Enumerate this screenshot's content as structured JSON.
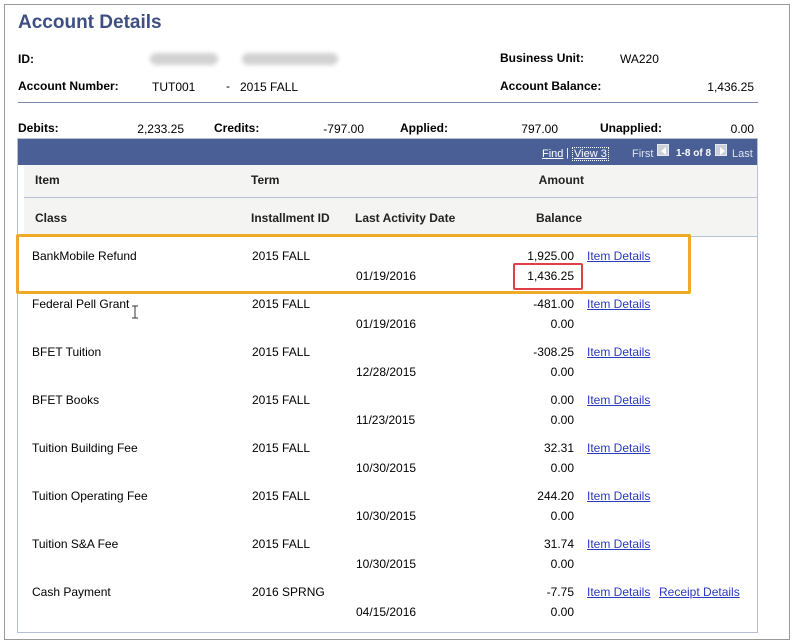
{
  "page": {
    "title": "Account Details",
    "id_label": "ID:",
    "account_number_label": "Account Number:",
    "account_number": "TUT001",
    "account_sep": "-",
    "account_term": "2015 FALL",
    "business_unit_label": "Business Unit:",
    "business_unit": "WA220",
    "account_balance_label": "Account Balance:",
    "account_balance": "1,436.25"
  },
  "summary": {
    "debits_label": "Debits:",
    "debits": "2,233.25",
    "credits_label": "Credits:",
    "credits": "-797.00",
    "applied_label": "Applied:",
    "applied": "797.00",
    "unapplied_label": "Unapplied:",
    "unapplied": "0.00"
  },
  "grid": {
    "find": "Find",
    "view": "View 3",
    "separator": "|",
    "first": "First",
    "range": "1-8 of 8",
    "last": "Last",
    "headers": {
      "item": "Item",
      "term": "Term",
      "amount": "Amount",
      "class": "Class",
      "installment": "Installment ID",
      "last_activity": "Last Activity Date",
      "balance": "Balance"
    },
    "rows": [
      {
        "item": "BankMobile Refund",
        "term": "2015 FALL",
        "date": "01/19/2016",
        "amount": "1,925.00",
        "balance": "1,436.25",
        "link": "Item Details",
        "link2": ""
      },
      {
        "item": "Federal Pell Grant",
        "term": "2015 FALL",
        "date": "01/19/2016",
        "amount": "-481.00",
        "balance": "0.00",
        "link": "Item Details",
        "link2": ""
      },
      {
        "item": "BFET Tuition",
        "term": "2015 FALL",
        "date": "12/28/2015",
        "amount": "-308.25",
        "balance": "0.00",
        "link": "Item Details",
        "link2": ""
      },
      {
        "item": "BFET Books",
        "term": "2015 FALL",
        "date": "11/23/2015",
        "amount": "0.00",
        "balance": "0.00",
        "link": "Item Details",
        "link2": ""
      },
      {
        "item": "Tuition Building Fee",
        "term": "2015 FALL",
        "date": "10/30/2015",
        "amount": "32.31",
        "balance": "0.00",
        "link": "Item Details",
        "link2": ""
      },
      {
        "item": "Tuition Operating Fee",
        "term": "2015 FALL",
        "date": "10/30/2015",
        "amount": "244.20",
        "balance": "0.00",
        "link": "Item Details",
        "link2": ""
      },
      {
        "item": "Tuition S&A Fee",
        "term": "2015 FALL",
        "date": "10/30/2015",
        "amount": "31.74",
        "balance": "0.00",
        "link": "Item Details",
        "link2": ""
      },
      {
        "item": "Cash Payment",
        "term": "2016 SPRNG",
        "date": "04/15/2016",
        "amount": "-7.75",
        "balance": "0.00",
        "link": "Item Details",
        "link2": "Receipt Details"
      }
    ]
  },
  "icons": {
    "prev": "arrow-left-icon",
    "next": "arrow-right-icon",
    "cursor": "text-cursor-icon"
  },
  "colors": {
    "title": "#3e4f82",
    "grid_bar": "#4a5f95",
    "link": "#2b38c2",
    "highlight_orange": "#f0aa29",
    "highlight_red": "#e03f48"
  }
}
